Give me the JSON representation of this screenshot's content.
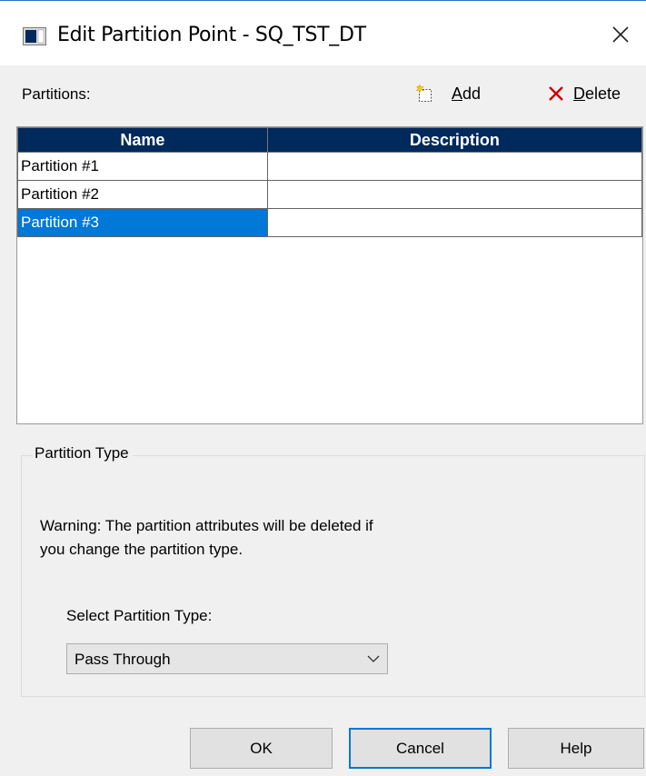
{
  "window": {
    "title": "Edit Partition Point - SQ_TST_DT",
    "icon": "app-window-icon",
    "close_icon": "close-icon"
  },
  "toolbar": {
    "partitions_label": "Partitions:",
    "add_label_prefix": "",
    "add_label_underline": "A",
    "add_label_rest": "dd",
    "delete_label_underline": "D",
    "delete_label_rest": "elete"
  },
  "table": {
    "columns": [
      "Name",
      "Description"
    ],
    "rows": [
      {
        "name": "Partition #1",
        "description": "",
        "selected": false
      },
      {
        "name": "Partition #2",
        "description": "",
        "selected": false
      },
      {
        "name": "Partition #3",
        "description": "",
        "selected": true
      }
    ]
  },
  "partition_type": {
    "legend": "Partition Type",
    "warning_line1": "Warning: The partition attributes will be deleted if",
    "warning_line2": "you change the partition type.",
    "select_label": "Select Partition Type:",
    "selected_value": "Pass Through"
  },
  "buttons": {
    "ok": "OK",
    "cancel": "Cancel",
    "help": "Help"
  },
  "colors": {
    "header_bg": "#00295c",
    "selection_bg": "#0078d7",
    "delete_icon": "#cc0000"
  }
}
